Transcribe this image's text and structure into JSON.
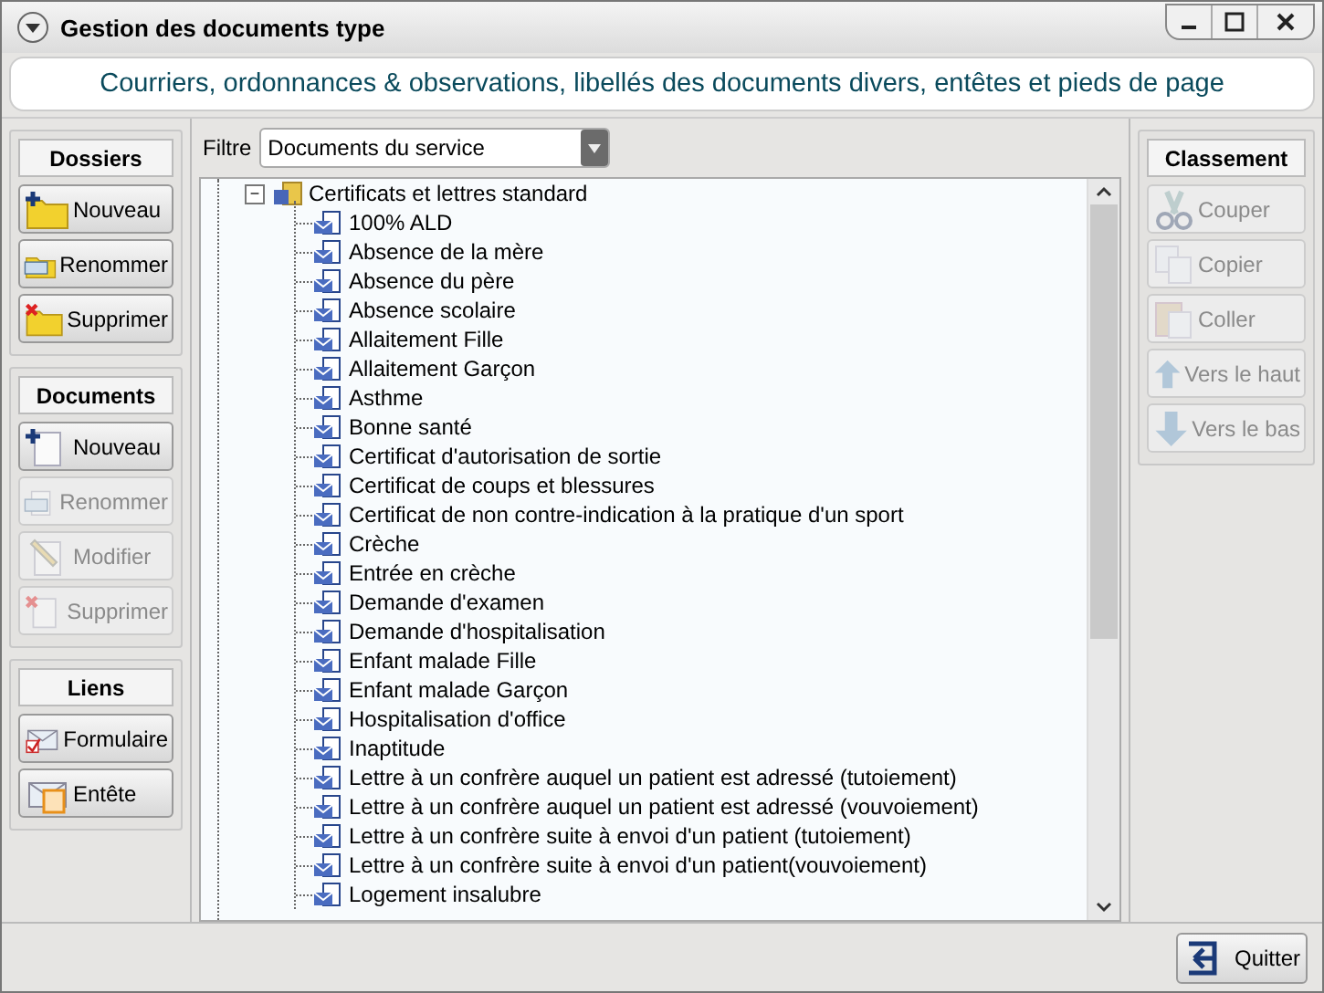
{
  "window": {
    "title": "Gestion des documents type"
  },
  "banner": "Courriers, ordonnances & observations, libellés des documents divers, entêtes et pieds de page",
  "left_groups": [
    {
      "title": "Dossiers",
      "buttons": [
        {
          "label": "Nouveau",
          "kind": "folder-add",
          "disabled": false
        },
        {
          "label": "Renommer",
          "kind": "folder-rename",
          "disabled": false
        },
        {
          "label": "Supprimer",
          "kind": "folder-delete",
          "disabled": false
        }
      ]
    },
    {
      "title": "Documents",
      "buttons": [
        {
          "label": "Nouveau",
          "kind": "doc-add",
          "disabled": false
        },
        {
          "label": "Renommer",
          "kind": "doc-rename",
          "disabled": true
        },
        {
          "label": "Modifier",
          "kind": "doc-edit",
          "disabled": true
        },
        {
          "label": "Supprimer",
          "kind": "doc-delete",
          "disabled": true
        }
      ]
    },
    {
      "title": "Liens",
      "buttons": [
        {
          "label": "Formulaire",
          "kind": "form",
          "disabled": false
        },
        {
          "label": "Entête",
          "kind": "header",
          "disabled": false
        }
      ]
    }
  ],
  "filter": {
    "label": "Filtre",
    "value": "Documents du service"
  },
  "tree": {
    "label": "Certificats et lettres standard",
    "expanded": true,
    "expander": "−",
    "children": [
      {
        "label": "100% ALD"
      },
      {
        "label": "Absence de la mère"
      },
      {
        "label": "Absence du père"
      },
      {
        "label": "Absence scolaire"
      },
      {
        "label": "Allaitement Fille"
      },
      {
        "label": "Allaitement Garçon"
      },
      {
        "label": "Asthme"
      },
      {
        "label": "Bonne santé"
      },
      {
        "label": "Certificat d'autorisation de sortie"
      },
      {
        "label": "Certificat de coups et blessures"
      },
      {
        "label": "Certificat de non contre-indication à la pratique d'un sport"
      },
      {
        "label": "Crèche"
      },
      {
        "label": "Entrée en crèche"
      },
      {
        "label": "Demande d'examen"
      },
      {
        "label": "Demande d'hospitalisation"
      },
      {
        "label": "Enfant malade Fille"
      },
      {
        "label": "Enfant malade Garçon"
      },
      {
        "label": "Hospitalisation d'office"
      },
      {
        "label": "Inaptitude"
      },
      {
        "label": "Lettre à un confrère auquel un patient est adressé (tutoiement)"
      },
      {
        "label": "Lettre à un confrère auquel un patient est adressé (vouvoiement)"
      },
      {
        "label": "Lettre à un confrère suite à envoi d'un patient (tutoiement)"
      },
      {
        "label": "Lettre à un confrère suite à envoi d'un patient(vouvoiement)"
      },
      {
        "label": "Logement insalubre"
      }
    ]
  },
  "right_group": {
    "title": "Classement",
    "buttons": [
      {
        "label": "Couper",
        "kind": "cut",
        "disabled": true
      },
      {
        "label": "Copier",
        "kind": "copy",
        "disabled": true
      },
      {
        "label": "Coller",
        "kind": "paste",
        "disabled": true
      },
      {
        "label": "Vers le haut",
        "kind": "up",
        "disabled": true
      },
      {
        "label": "Vers le bas",
        "kind": "down",
        "disabled": true
      }
    ]
  },
  "quit_button": "Quitter"
}
